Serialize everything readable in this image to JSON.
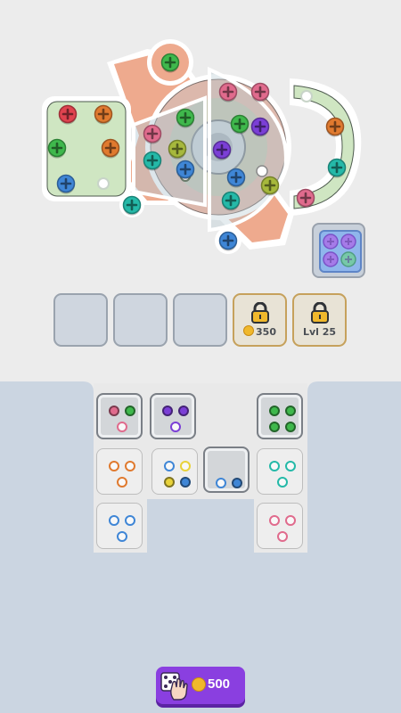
{
  "board": {
    "screws": [
      "red",
      "orange",
      "green",
      "orange",
      "blue",
      "green",
      "pink",
      "teal",
      "olive",
      "green",
      "purple",
      "blue",
      "teal",
      "green",
      "pink",
      "pink",
      "purple",
      "blue",
      "olive",
      "teal",
      "blue",
      "pink",
      "teal",
      "orange",
      "pink"
    ],
    "booster_icon": "four-screws-box-icon"
  },
  "slots": {
    "empty_count": 3,
    "locked": [
      {
        "label": "350",
        "icon": "coin-icon"
      },
      {
        "label": "Lvl 25",
        "icon": "lock-icon"
      }
    ]
  },
  "boxes": [
    {
      "colors": [
        "pink",
        "green",
        "pink"
      ],
      "filled": [
        true,
        true,
        false
      ],
      "style": "dark"
    },
    {
      "colors": [
        "purple",
        "purple",
        "purple"
      ],
      "filled": [
        true,
        true,
        false
      ],
      "style": "dark"
    },
    {
      "colors": [
        "green",
        "green",
        "green",
        "green"
      ],
      "filled": [
        true,
        true,
        true,
        true
      ],
      "style": "dark"
    },
    {
      "colors": [
        "orange",
        "orange",
        "orange"
      ],
      "filled": [
        false,
        false,
        false
      ],
      "style": "light"
    },
    {
      "colors": [
        "blue",
        "yellow",
        "yellow",
        "blue"
      ],
      "filled": [
        false,
        false,
        true,
        true
      ],
      "style": "light"
    },
    {
      "colors": [
        "blue",
        "blue"
      ],
      "filled": [
        false,
        true
      ],
      "style": "dark"
    },
    {
      "colors": [
        "teal",
        "teal",
        "teal"
      ],
      "filled": [
        false,
        false,
        false
      ],
      "style": "light"
    },
    {
      "colors": [
        "blue",
        "blue",
        "blue"
      ],
      "filled": [
        false,
        false,
        false
      ],
      "style": "light"
    },
    {
      "colors": [
        "pink",
        "pink",
        "pink"
      ],
      "filled": [
        false,
        false,
        false
      ],
      "style": "light"
    }
  ],
  "buy_button": {
    "price": "500",
    "icon": "dice-hand-icon"
  },
  "palette": {
    "red": "#e0434f",
    "orange": "#e07a2f",
    "green": "#3fb84c",
    "blue": "#3f86d6",
    "pink": "#e06b8d",
    "teal": "#25b9a8",
    "olive": "#a6b83c",
    "purple": "#7b3fd6",
    "yellow": "#e8d23a"
  }
}
